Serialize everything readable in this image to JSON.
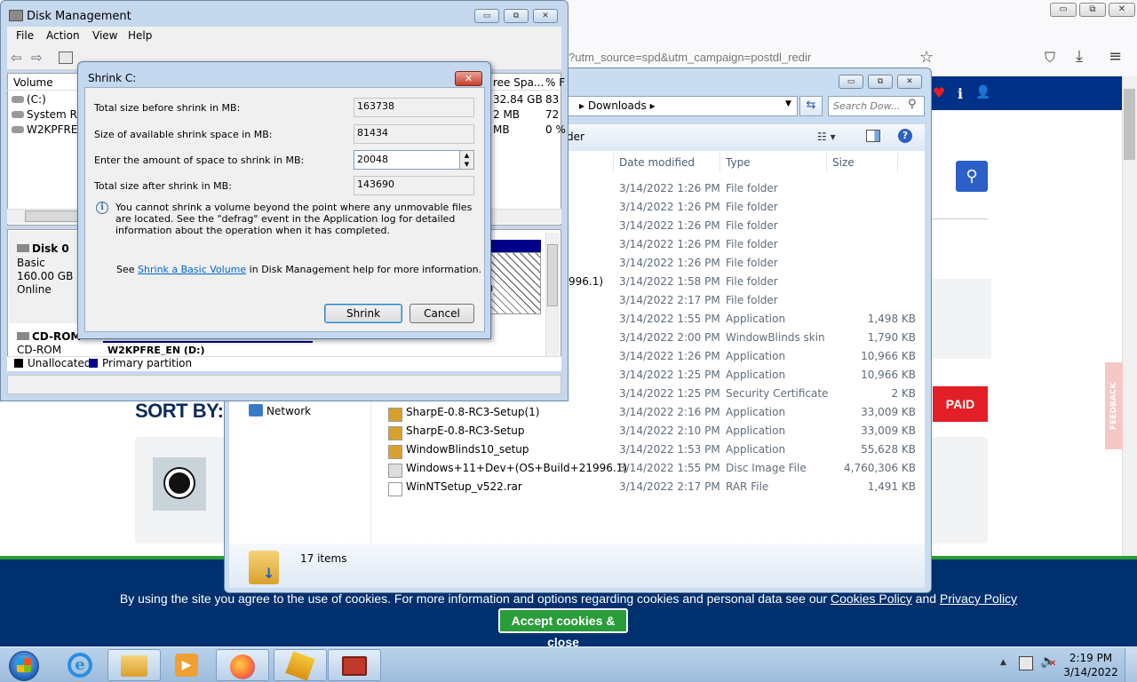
{
  "browser": {
    "url_fragment": "?utm_source=spd&utm_campaign=postdl_redir",
    "sort_by": "SORT BY:",
    "paid_label": "PAID",
    "feedback_label": "FEEDBACK",
    "cookie_text_pre": "By using the site you agree to the use of cookies. For more information and options regarding cookies and personal data see our",
    "cookie_policy": "Cookies Policy",
    "cookie_and": "and",
    "privacy_policy": "Privacy Policy",
    "cookie_button": "Accept cookies & close",
    "win_minimize": "▭",
    "win_restore": "⧉",
    "win_close": "✕",
    "shield": "⛉",
    "download": "⤓",
    "menu": "≡",
    "star": "☆",
    "search_icon": "⚲",
    "heart": "♥",
    "info": "i",
    "user": "👤"
  },
  "explorer": {
    "breadcrumb": "Downloads",
    "search_placeholder": "Search Dow...",
    "toolbar_fragment": "der",
    "col_date": "Date modified",
    "col_type": "Type",
    "col_size": "Size",
    "nav_network": "Network",
    "status_count": "17 items",
    "rows": [
      {
        "name": "",
        "date": "3/14/2022 1:26 PM",
        "type": "File folder",
        "size": ""
      },
      {
        "name": "",
        "date": "3/14/2022 1:26 PM",
        "type": "File folder",
        "size": ""
      },
      {
        "name": "",
        "date": "3/14/2022 1:26 PM",
        "type": "File folder",
        "size": ""
      },
      {
        "name": "",
        "date": "3/14/2022 1:26 PM",
        "type": "File folder",
        "size": ""
      },
      {
        "name": "",
        "date": "3/14/2022 1:26 PM",
        "type": "File folder",
        "size": ""
      },
      {
        "name": "996.1)",
        "date": "3/14/2022 1:58 PM",
        "type": "File folder",
        "size": ""
      },
      {
        "name": "",
        "date": "3/14/2022 2:17 PM",
        "type": "File folder",
        "size": ""
      },
      {
        "name": "",
        "date": "3/14/2022 1:55 PM",
        "type": "Application",
        "size": "1,498 KB"
      },
      {
        "name": "",
        "date": "3/14/2022 2:00 PM",
        "type": "WindowBlinds skin",
        "size": "1,790 KB"
      },
      {
        "name": "",
        "date": "3/14/2022 1:26 PM",
        "type": "Application",
        "size": "10,966 KB"
      },
      {
        "name": "",
        "date": "3/14/2022 1:25 PM",
        "type": "Application",
        "size": "10,966 KB"
      },
      {
        "name": "",
        "date": "3/14/2022 1:25 PM",
        "type": "Security Certificate",
        "size": "2 KB"
      },
      {
        "name": "SharpE-0.8-RC3-Setup(1)",
        "date": "3/14/2022 2:16 PM",
        "type": "Application",
        "size": "33,009 KB"
      },
      {
        "name": "SharpE-0.8-RC3-Setup",
        "date": "3/14/2022 2:10 PM",
        "type": "Application",
        "size": "33,009 KB"
      },
      {
        "name": "WindowBlinds10_setup",
        "date": "3/14/2022 1:53 PM",
        "type": "Application",
        "size": "55,628 KB"
      },
      {
        "name": "Windows+11+Dev+(OS+Build+21996.1)",
        "date": "3/14/2022 1:55 PM",
        "type": "Disc Image File",
        "size": "4,760,306 KB"
      },
      {
        "name": "WinNTSetup_v522.rar",
        "date": "3/14/2022 2:17 PM",
        "type": "RAR File",
        "size": "1,491 KB"
      }
    ]
  },
  "diskmgmt": {
    "title": "Disk Management",
    "menus": [
      "File",
      "Action",
      "View",
      "Help"
    ],
    "col_volume": "Volume",
    "col_free": "ree Spa...",
    "col_pct": "% F",
    "volumes": [
      {
        "name": "(C:)",
        "free": "32.84 GB",
        "pct": "83"
      },
      {
        "name": "System Res",
        "free": "2 MB",
        "pct": "72"
      },
      {
        "name": "W2KPFRE_I",
        "free": "MB",
        "pct": "0 %"
      }
    ],
    "disk0_label": "Disk 0",
    "disk0_type": "Basic",
    "disk0_size": "160.00 GB",
    "disk0_status": "Online",
    "cdrom_label": "CD-ROM",
    "cdrom_type": "CD-ROM",
    "cdrom_vol": "W2KPFRE_EN (D:)",
    "partition_tail": ")",
    "legend_unalloc": "Unallocated",
    "legend_primary": "Primary partition"
  },
  "shrink": {
    "title": "Shrink C:",
    "label_before": "Total size before shrink in MB:",
    "value_before": "163738",
    "label_available": "Size of available shrink space in MB:",
    "value_available": "81434",
    "label_amount": "Enter the amount of space to shrink in MB:",
    "value_amount": "20048",
    "label_after": "Total size after shrink in MB:",
    "value_after": "143690",
    "info": "You cannot shrink a volume beyond the point where any unmovable files are located. See the \"defrag\" event in the Application log for detailed information about the operation when it has completed.",
    "see_pre": "See",
    "see_link": "Shrink a Basic Volume",
    "see_post": "in Disk Management help for more information.",
    "shrink_button": "Shrink",
    "cancel_button": "Cancel"
  },
  "taskbar": {
    "time": "2:19 PM",
    "date": "3/14/2022"
  }
}
